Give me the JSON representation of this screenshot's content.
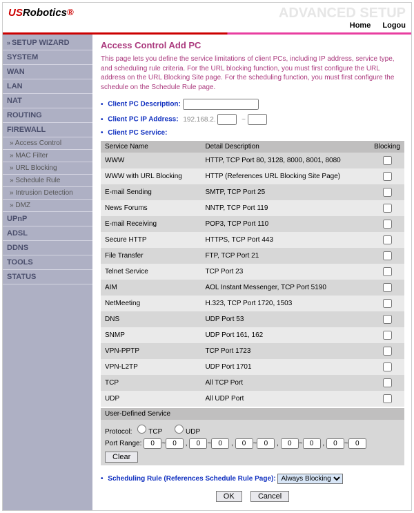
{
  "brand": {
    "part1": "US",
    "part2": "Robotics",
    "mark": "®"
  },
  "header_ghost": "ADVANCED SETUP",
  "top_links": {
    "home": "Home",
    "logout": "Logou"
  },
  "sidebar": {
    "wizard": "SETUP WIZARD",
    "groups": [
      "SYSTEM",
      "WAN",
      "LAN",
      "NAT",
      "ROUTING",
      "FIREWALL"
    ],
    "firewall_subs": [
      "Access Control",
      "MAC Filter",
      "URL Blocking",
      "Schedule Rule",
      "Intrusion Detection",
      "DMZ"
    ],
    "groups2": [
      "UPnP",
      "ADSL",
      "DDNS",
      "TOOLS",
      "STATUS"
    ]
  },
  "page": {
    "title": "Access Control Add PC",
    "intro": "This page lets you define the service limitations of client PCs, including IP address, service type, and scheduling rule criteria. For the URL blocking function, you must first configure the URL address on the URL Blocking Site page. For the scheduling function, you must first configure the schedule on the Schedule Rule page.",
    "desc_label": "Client PC Description:",
    "ip_label": "Client PC IP Address:",
    "ip_prefix": "192.168.2.",
    "ip_sep": "~",
    "svc_label": "Client PC Service:",
    "table_headers": {
      "name": "Service Name",
      "detail": "Detail Description",
      "block": "Blocking"
    },
    "services": [
      {
        "name": "WWW",
        "detail": "HTTP, TCP Port 80, 3128, 8000, 8001, 8080"
      },
      {
        "name": "WWW with URL Blocking",
        "detail": "HTTP (References URL Blocking Site Page)"
      },
      {
        "name": "E-mail Sending",
        "detail": "SMTP, TCP Port 25"
      },
      {
        "name": "News Forums",
        "detail": "NNTP, TCP Port 119"
      },
      {
        "name": "E-mail Receiving",
        "detail": "POP3, TCP Port 110"
      },
      {
        "name": "Secure HTTP",
        "detail": "HTTPS, TCP Port 443"
      },
      {
        "name": "File Transfer",
        "detail": "FTP, TCP Port 21"
      },
      {
        "name": "Telnet Service",
        "detail": "TCP Port 23"
      },
      {
        "name": "AIM",
        "detail": "AOL Instant Messenger, TCP Port 5190"
      },
      {
        "name": "NetMeeting",
        "detail": "H.323, TCP Port 1720, 1503"
      },
      {
        "name": "DNS",
        "detail": "UDP Port 53"
      },
      {
        "name": "SNMP",
        "detail": "UDP Port 161, 162"
      },
      {
        "name": "VPN-PPTP",
        "detail": "TCP Port 1723"
      },
      {
        "name": "VPN-L2TP",
        "detail": "UDP Port 1701"
      },
      {
        "name": "TCP",
        "detail": "All TCP Port"
      },
      {
        "name": "UDP",
        "detail": "All UDP Port"
      }
    ],
    "user_def": {
      "title": "User-Defined Service",
      "proto_label": "Protocol:",
      "tcp": "TCP",
      "udp": "UDP",
      "range_label": "Port Range:",
      "zero": "0",
      "clear": "Clear"
    },
    "rule_label": "Scheduling Rule (References Schedule Rule Page):",
    "rule_selected": "Always Blocking",
    "ok": "OK",
    "cancel": "Cancel"
  }
}
